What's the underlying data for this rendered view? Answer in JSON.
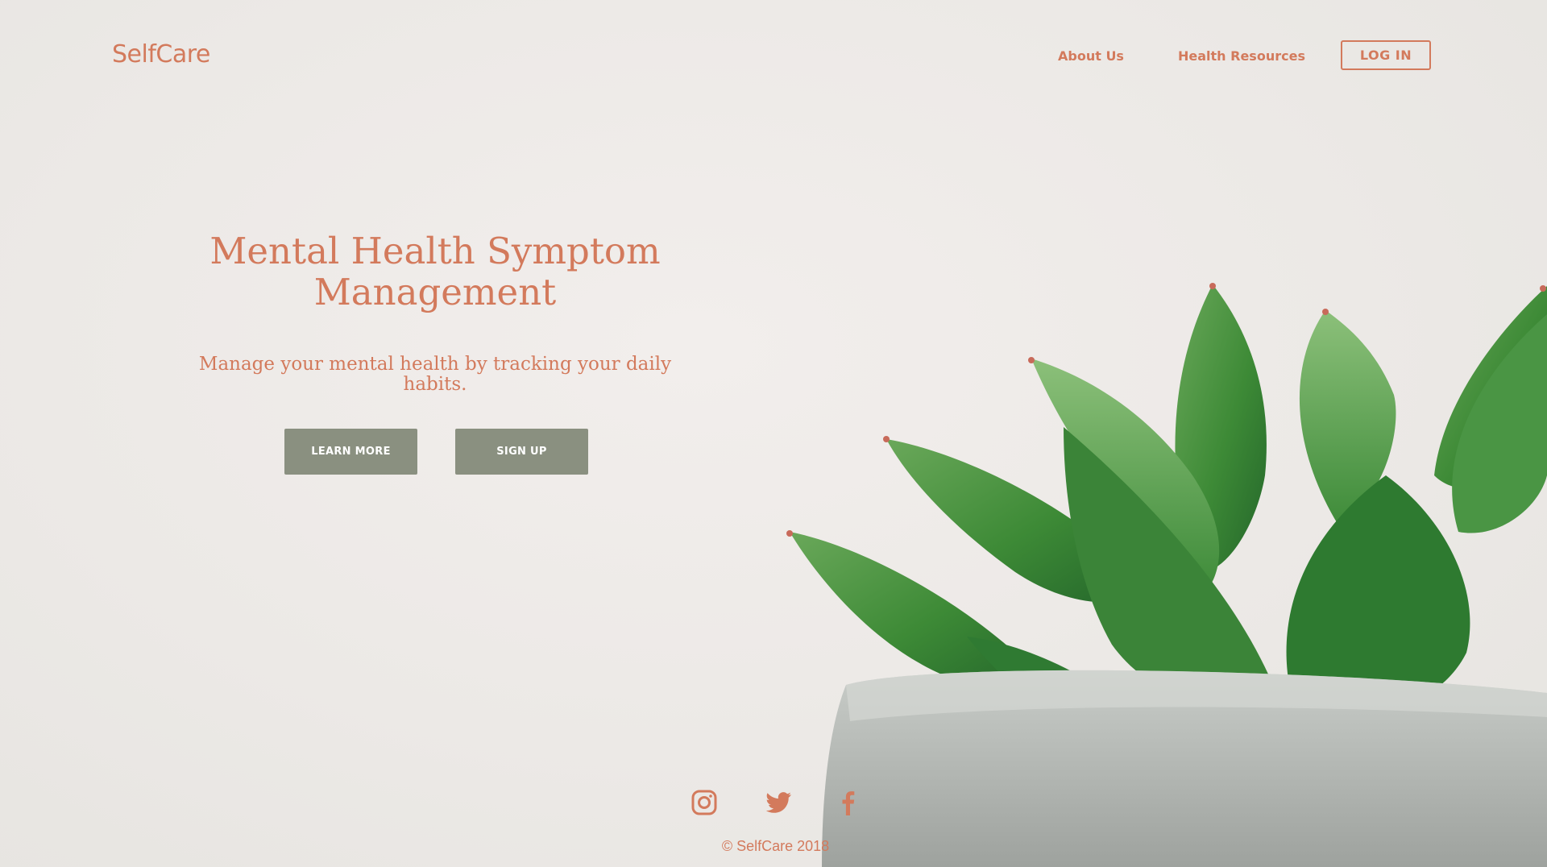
{
  "header": {
    "brand": "SelfCare",
    "nav": {
      "about": "About Us",
      "resources": "Health Resources",
      "login": "LOG IN"
    }
  },
  "hero": {
    "title": "Mental Health Symptom Management",
    "subtitle": "Manage your mental health by tracking your daily habits.",
    "learn_more": "LEARN MORE",
    "sign_up": "SIGN UP"
  },
  "footer": {
    "social": [
      "instagram-icon",
      "twitter-icon",
      "facebook-icon"
    ],
    "copyright": "© SelfCare 2018"
  },
  "colors": {
    "accent": "#d37a5c",
    "button": "#8a9080",
    "background": "#ece9e6",
    "plant_green": "#3f8a3a",
    "pot_gray": "#b8bcb8"
  }
}
